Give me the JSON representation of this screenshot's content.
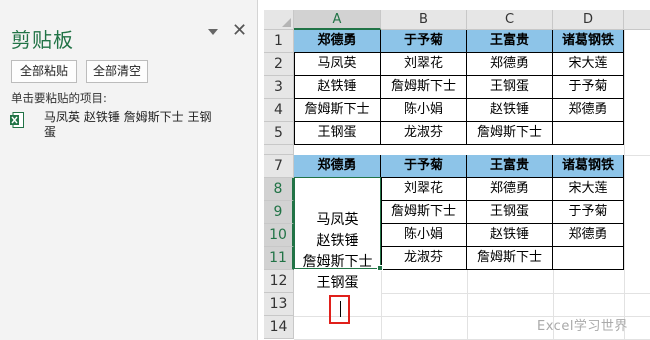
{
  "clipboard": {
    "title": "剪贴板",
    "paste_all_label": "全部粘贴",
    "clear_all_label": "全部清空",
    "hint": "单击要粘贴的项目:",
    "close_glyph": "✕",
    "items": [
      {
        "line1": "马凤英 赵铁锤 詹姆斯下士 王钢",
        "line2": "蛋",
        "icon": "excel-icon"
      }
    ]
  },
  "sheet": {
    "columns": [
      "A",
      "B",
      "C",
      "D"
    ],
    "selected_column": "A",
    "rows": [
      "1",
      "2",
      "3",
      "4",
      "5",
      "6",
      "7",
      "8",
      "9",
      "10",
      "11",
      "12",
      "13",
      "14"
    ],
    "selected_rows": [
      "8",
      "9",
      "10",
      "11"
    ],
    "table1": {
      "header": [
        "郑德勇",
        "于予菊",
        "王富贵",
        "诸葛钢铁"
      ],
      "rows": [
        [
          "马凤英",
          "刘翠花",
          "郑德勇",
          "宋大莲"
        ],
        [
          "赵铁锤",
          "詹姆斯下士",
          "王钢蛋",
          "于予菊"
        ],
        [
          "詹姆斯下士",
          "陈小娟",
          "赵铁锤",
          "郑德勇"
        ],
        [
          "王钢蛋",
          "龙淑芬",
          "詹姆斯下士",
          ""
        ]
      ]
    },
    "table2": {
      "header": [
        "郑德勇",
        "于予菊",
        "王富贵",
        "诸葛钢铁"
      ],
      "col_a_multiline": [
        "马凤英",
        "赵铁锤",
        "詹姆斯下士",
        "王钢蛋"
      ],
      "rows": [
        [
          "刘翠花",
          "郑德勇",
          "宋大莲"
        ],
        [
          "詹姆斯下士",
          "王钢蛋",
          "于予菊"
        ],
        [
          "陈小娟",
          "赵铁锤",
          "郑德勇"
        ],
        [
          "龙淑芬",
          "詹姆斯下士",
          ""
        ]
      ]
    }
  },
  "watermark": "Excel学习世界",
  "colors": {
    "accent": "#217346",
    "header_fill": "#8dc4e8",
    "highlight": "#e0201b"
  }
}
